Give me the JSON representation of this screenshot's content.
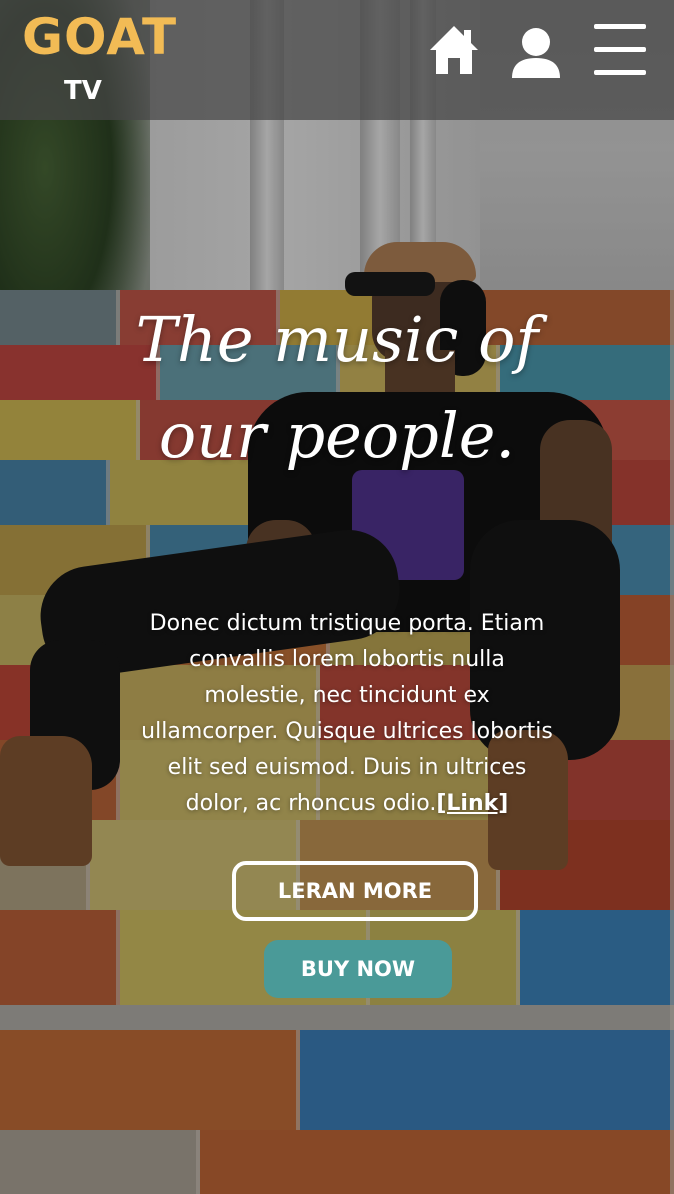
{
  "header": {
    "logo_main": "GOAT",
    "logo_sub": "TV",
    "icons": [
      "home-icon",
      "user-icon",
      "menu-icon"
    ]
  },
  "hero": {
    "headline_line1": "The music of",
    "headline_line2": "our people.",
    "body": "Donec dictum tristique porta. Etiam convallis lorem lobortis nulla molestie, nec tincidunt ex ullamcorper. Quisque ultrices lobortis elit sed euismod. Duis in ultrices dolor, ac rhoncus odio.",
    "link_label": "[Link]",
    "learn_more_label": "LERAN MORE",
    "buy_now_label": "BUY NOW"
  },
  "colors": {
    "logo": "#f2bb55",
    "buy_button": "#4a9a98",
    "header_bg": "rgba(70,70,70,0.72)"
  }
}
